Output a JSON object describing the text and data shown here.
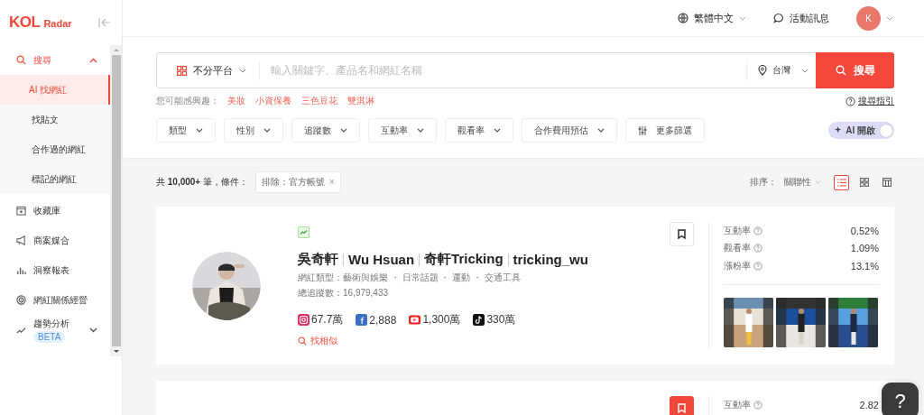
{
  "sidebar": {
    "logo": {
      "brand": "KOL",
      "suffix": "Radar"
    },
    "nav": [
      {
        "label": "搜尋",
        "expanded": true,
        "children": [
          {
            "label": "AI 找網紅",
            "selected": true
          },
          {
            "label": "找貼文",
            "selected": false
          },
          {
            "label": "合作過的網紅",
            "selected": false
          },
          {
            "label": "標記的網紅",
            "selected": false
          }
        ]
      },
      {
        "label": "收藏庫"
      },
      {
        "label": "商案媒合"
      },
      {
        "label": "洞察報表"
      },
      {
        "label": "網紅關係經營"
      },
      {
        "label": "趨勢分析",
        "badge": "BETA",
        "expanded": false
      }
    ]
  },
  "top_bar": {
    "language": "繁體中文",
    "messages": "活動訊息",
    "avatar": "K"
  },
  "search": {
    "platform": "不分平台",
    "placeholder": "輸入關鍵字、產品名和網紅名稱",
    "region": "台灣",
    "button": "搜尋",
    "suggest_label": "您可能感興趣：",
    "suggestions": [
      "美妝",
      "小資保養",
      "三色豆花",
      "雙淇淋"
    ],
    "guide": "搜尋指引",
    "filters": [
      "類型",
      "性別",
      "追蹤數",
      "互動率",
      "觀看率",
      "合作費用預估"
    ],
    "more_filters": "更多篩選",
    "ai_toggle": {
      "label": "AI 開啟",
      "on": true
    }
  },
  "results": {
    "summary": "共 **10,000+** 筆，條件：",
    "chips": [
      {
        "label": "排除：官方帳號",
        "close": "×"
      }
    ],
    "sort_label": "排序：",
    "sort_value": "關聯性",
    "views": [
      {
        "selected": true
      },
      {
        "selected": false
      },
      {
        "selected": false
      }
    ],
    "cards": [
      {
        "trending": true,
        "names": [
          "吳奇軒",
          "Wu Hsuan",
          "奇軒Tricking",
          "tricking_wu"
        ],
        "categories": "網紅類型：藝術與娛樂 ・ 日常話題 ・ 運動 ・ 交通工具",
        "followers": "總追蹤數：16,979,433",
        "socials": [
          {
            "kind": "instagram",
            "count": "67.7萬"
          },
          {
            "kind": "facebook",
            "count": "2,888"
          },
          {
            "kind": "youtube",
            "count": "1,300萬"
          },
          {
            "kind": "tiktok",
            "count": "330萬"
          }
        ],
        "similar": "找相似",
        "saved": false,
        "stats": [
          {
            "label": "互動率",
            "value": "0.52%"
          },
          {
            "label": "觀看率",
            "value": "1.09%"
          },
          {
            "label": "漲粉率",
            "value": "13.1%"
          }
        ],
        "posts": [
          {
            "kind": "picture"
          },
          {
            "kind": "picture"
          },
          {
            "kind": "picture"
          }
        ]
      },
      {
        "saved": true,
        "stats": [
          {
            "label": "互動率",
            "value": "2.82"
          }
        ]
      }
    ]
  },
  "help_button": "?"
}
